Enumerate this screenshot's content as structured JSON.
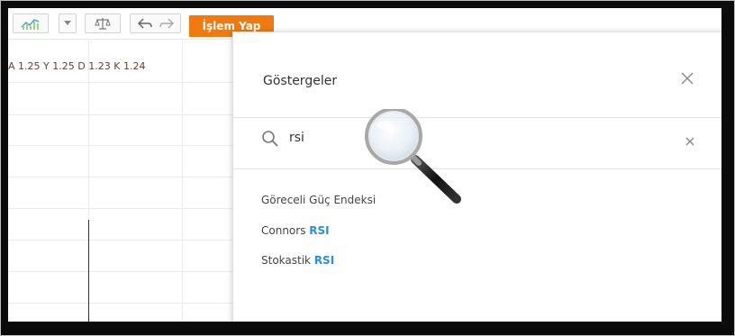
{
  "toolbar": {
    "chart_type_icon": "area-chart-icon",
    "dropdown_icon": "chevron-down-icon",
    "compare_icon": "balance-scale-icon",
    "undo_icon": "undo-arrow-icon",
    "redo_icon": "redo-arrow-icon",
    "trade_button_label": "İşlem Yap",
    "trade_button_color": "#f07a10"
  },
  "ohlc": {
    "open_label": "A",
    "open_value": "1.25",
    "high_label": "Y",
    "high_value": "1.25",
    "low_label": "D",
    "low_value": "1.23",
    "close_label": "K",
    "close_value": "1.24"
  },
  "indicator_panel": {
    "title": "Göstergeler",
    "close_icon": "close-icon",
    "search": {
      "icon": "search-icon",
      "value": "rsi",
      "clear_icon": "clear-icon"
    },
    "results": [
      {
        "prefix": "Göreceli Güç Endeksi",
        "highlight": ""
      },
      {
        "prefix": "Connors ",
        "highlight": "RSI"
      },
      {
        "prefix": "Stokastik ",
        "highlight": "RSI"
      }
    ],
    "highlight_color": "#2a8fd6"
  },
  "overlay": {
    "magnifier_icon": "magnifying-glass-icon"
  }
}
